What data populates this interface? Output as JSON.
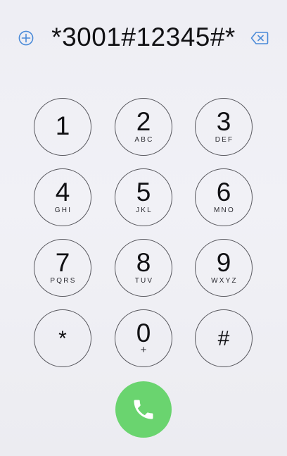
{
  "dialer": {
    "number": "*3001#12345#*",
    "icons": {
      "add": "plus-circle-icon",
      "delete": "backspace-icon",
      "call": "phone-icon"
    }
  },
  "keypad": {
    "keys": [
      {
        "digit": "1",
        "letters": ""
      },
      {
        "digit": "2",
        "letters": "ABC"
      },
      {
        "digit": "3",
        "letters": "DEF"
      },
      {
        "digit": "4",
        "letters": "GHI"
      },
      {
        "digit": "5",
        "letters": "JKL"
      },
      {
        "digit": "6",
        "letters": "MNO"
      },
      {
        "digit": "7",
        "letters": "PQRS"
      },
      {
        "digit": "8",
        "letters": "TUV"
      },
      {
        "digit": "9",
        "letters": "WXYZ"
      },
      {
        "digit": "*",
        "letters": ""
      },
      {
        "digit": "0",
        "letters": "+"
      },
      {
        "digit": "#",
        "letters": ""
      }
    ]
  },
  "colors": {
    "call_button": "#6ad46f",
    "accent_icon": "#4a8ad8",
    "key_border": "#58585e",
    "background": "#eeeef4"
  }
}
